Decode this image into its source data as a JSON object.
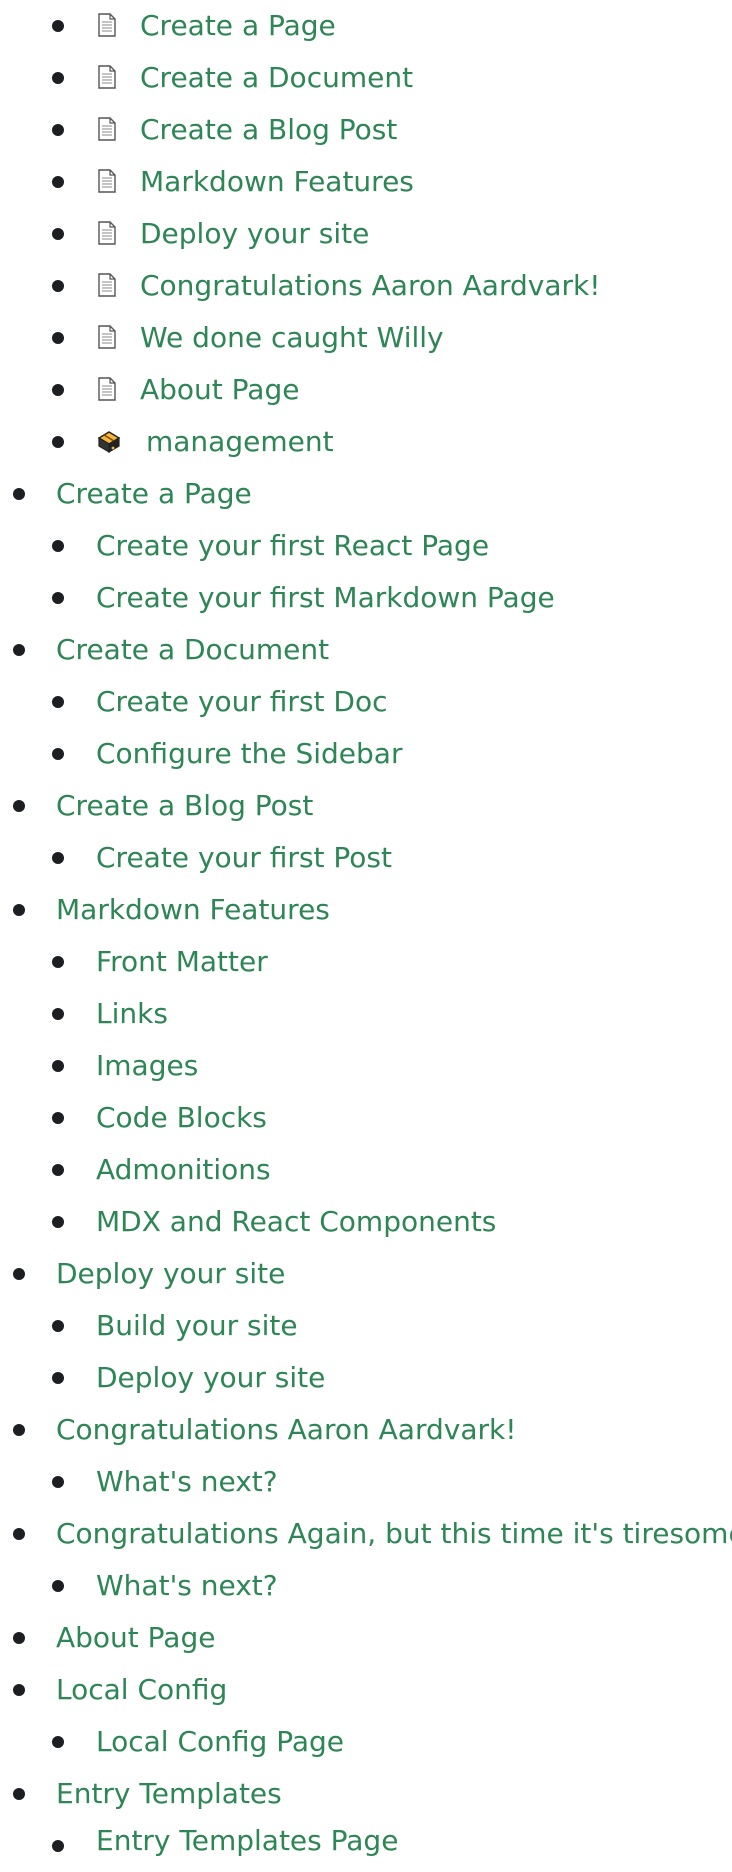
{
  "top_nav": [
    {
      "label": "Create a Page",
      "icon": "page-icon"
    },
    {
      "label": "Create a Document",
      "icon": "page-icon"
    },
    {
      "label": "Create a Blog Post",
      "icon": "page-icon"
    },
    {
      "label": "Markdown Features",
      "icon": "page-icon"
    },
    {
      "label": "Deploy your site",
      "icon": "page-icon"
    },
    {
      "label": "Congratulations Aaron Aardvark!",
      "icon": "page-icon"
    },
    {
      "label": "We done caught Willy",
      "icon": "page-icon"
    },
    {
      "label": "About Page",
      "icon": "page-icon"
    },
    {
      "label": "management",
      "icon": "package-icon"
    }
  ],
  "sections": [
    {
      "title": "Create a Page",
      "children": [
        "Create your first React Page",
        "Create your first Markdown Page"
      ]
    },
    {
      "title": "Create a Document",
      "children": [
        "Create your first Doc",
        "Configure the Sidebar"
      ]
    },
    {
      "title": "Create a Blog Post",
      "children": [
        "Create your first Post"
      ]
    },
    {
      "title": "Markdown Features",
      "children": [
        "Front Matter",
        "Links",
        "Images",
        "Code Blocks",
        "Admonitions",
        "MDX and React Components"
      ]
    },
    {
      "title": "Deploy your site",
      "children": [
        "Build your site",
        "Deploy your site"
      ]
    },
    {
      "title": "Congratulations Aaron Aardvark!",
      "children": [
        "What's next?"
      ]
    },
    {
      "title": "Congratulations Again, but this time it's tiresome",
      "children": [
        "What's next?"
      ]
    },
    {
      "title": "About Page",
      "children": []
    },
    {
      "title": "Local Config",
      "children": [
        "Local Config Page"
      ]
    },
    {
      "title": "Entry Templates",
      "children": [
        "Entry Templates Page"
      ]
    }
  ],
  "colors": {
    "link": "#2e8555",
    "bullet": "#1c1e21"
  }
}
